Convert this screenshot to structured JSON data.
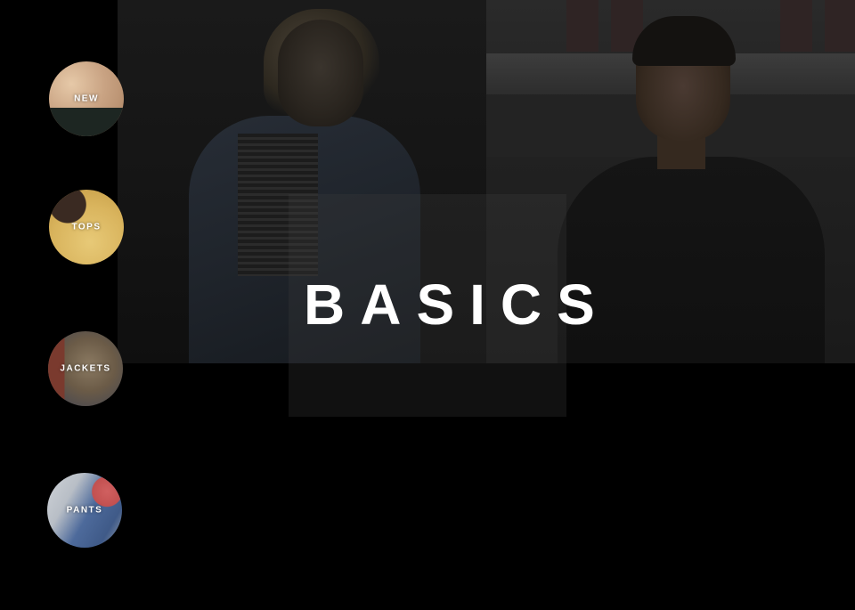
{
  "hero": {
    "title": "BASICS"
  },
  "categories": [
    {
      "label": "NEW"
    },
    {
      "label": "TOPS"
    },
    {
      "label": "JACKETS"
    },
    {
      "label": "PANTS"
    }
  ]
}
